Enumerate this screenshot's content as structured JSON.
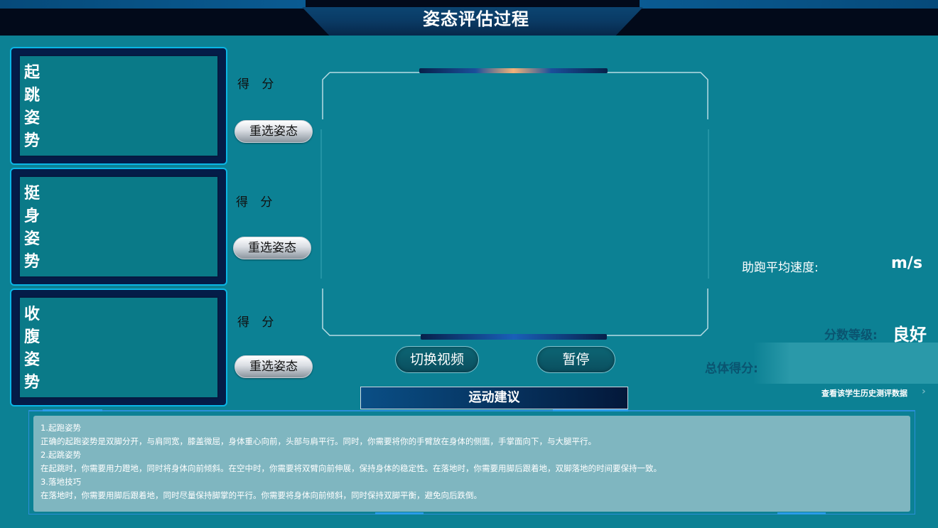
{
  "header": {
    "title": "姿态评估过程"
  },
  "postures": [
    {
      "title": "起跳姿势",
      "score_label": "得 分",
      "reselect_label": "重选姿态"
    },
    {
      "title": "挺身姿势",
      "score_label": "得 分",
      "reselect_label": "重选姿态"
    },
    {
      "title": "收腹姿势",
      "score_label": "得 分",
      "reselect_label": "重选姿态"
    }
  ],
  "video": {
    "switch_label": "切换视频",
    "pause_label": "暂停"
  },
  "stats": {
    "speed_label": "助跑平均速度:",
    "speed_unit": "m/s",
    "grade_label": "分数等级:",
    "grade_value": "良好",
    "total_label": "总体得分:",
    "history_link": "查看该学生历史测评数据",
    "history_arrow": "›"
  },
  "advice": {
    "title": "运动建议",
    "lines": [
      "1.起跑姿势",
      "正确的起跑姿势是双脚分开，与肩同宽，膝盖微屈，身体重心向前，头部与肩平行。同时，你需要将你的手臂放在身体的侧面，手掌面向下，与大腿平行。",
      "2.起跳姿势",
      "在起跳时，你需要用力蹬地，同时将身体向前倾斜。在空中时，你需要将双臂向前伸展，保持身体的稳定性。在落地时，你需要用脚后跟着地，双脚落地的时间要保持一致。",
      "3.落地技巧",
      "在落地时，你需要用脚后跟着地，同时尽量保持脚掌的平行。你需要将身体向前倾斜，同时保持双脚平衡，避免向后跌倒。"
    ]
  },
  "colors": {
    "background": "#0c8194",
    "header": "#020a1a",
    "panel_border": "#0ab6e6",
    "advice_box": "#7fb6c0"
  }
}
